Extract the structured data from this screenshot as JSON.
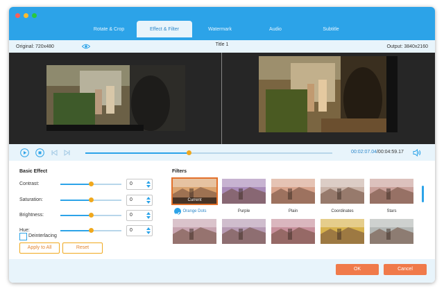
{
  "window": {
    "traffic_lights": [
      "#ff5f57",
      "#febc2e",
      "#28c840"
    ]
  },
  "tabs": [
    {
      "label": "Rotate & Crop",
      "active": false
    },
    {
      "label": "Effect & Filter",
      "active": true
    },
    {
      "label": "Watermark",
      "active": false
    },
    {
      "label": "Audio",
      "active": false
    },
    {
      "label": "Subtitle",
      "active": false
    }
  ],
  "info": {
    "original": "Original: 720x480",
    "title": "Title 1",
    "output": "Output: 3840x2160"
  },
  "playback": {
    "current_time": "00:02:07.04",
    "total_time": "/00:04:59.17",
    "progress": 0.42
  },
  "basic_effect": {
    "heading": "Basic Effect",
    "controls": [
      {
        "label": "Contrast:",
        "value": "0",
        "level": 0.5
      },
      {
        "label": "Saturation:",
        "value": "0",
        "level": 0.5
      },
      {
        "label": "Brightness:",
        "value": "0",
        "level": 0.5
      },
      {
        "label": "Hue:",
        "value": "0",
        "level": 0.5
      }
    ],
    "deinterlacing_label": "Deinterlacing",
    "deinterlacing_checked": false,
    "apply_to_all": "Apply to All",
    "reset": "Reset"
  },
  "filters": {
    "heading": "Filters",
    "current_caption": "Current",
    "items": [
      {
        "name": "Orange Dots",
        "selected": true,
        "tint": "#d9a36f"
      },
      {
        "name": "Purple",
        "selected": false,
        "tint": "#a98bb8"
      },
      {
        "name": "Plain",
        "selected": false,
        "tint": "#d8a38c"
      },
      {
        "name": "Coordinates",
        "selected": false,
        "tint": "#c9b3a8"
      },
      {
        "name": "Stars",
        "selected": false,
        "tint": "#c9a09a"
      },
      {
        "name": "",
        "selected": false,
        "tint": "#c7a4b0"
      },
      {
        "name": "",
        "selected": false,
        "tint": "#b69ab3"
      },
      {
        "name": "",
        "selected": false,
        "tint": "#c78f9b"
      },
      {
        "name": "",
        "selected": false,
        "tint": "#d7b24d"
      },
      {
        "name": "",
        "selected": false,
        "tint": "#b4b8b6"
      }
    ]
  },
  "footer": {
    "ok": "OK",
    "cancel": "Cancel",
    "button_color": "#f07a4a"
  },
  "colors": {
    "accent": "#2ca3e8",
    "orange": "#f0a81d"
  }
}
